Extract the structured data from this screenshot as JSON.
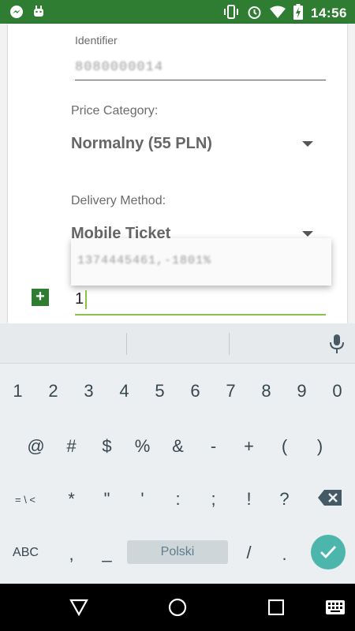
{
  "status_bar": {
    "time": "14:56",
    "left_icons": [
      "messenger-icon",
      "android-icon"
    ],
    "right_icons": [
      "vibrate-icon",
      "alarm-icon",
      "wifi-icon",
      "battery-icon"
    ]
  },
  "form": {
    "identifier_label": "Identifier",
    "identifier_value": "8080000014",
    "price_label": "Price Category:",
    "price_value": "Normalny (55 PLN)",
    "delivery_label": "Delivery Method:",
    "delivery_value": "Mobile Ticket",
    "autocomplete_suggestion": "1374445461,-1801%",
    "quantity_value": "1"
  },
  "keyboard": {
    "row1": [
      "1",
      "2",
      "3",
      "4",
      "5",
      "6",
      "7",
      "8",
      "9",
      "0"
    ],
    "row2": [
      "@",
      "#",
      "$",
      "%",
      "&",
      "-",
      "+",
      "(",
      ")"
    ],
    "row3": [
      "= \\ <",
      "*",
      "\"",
      "'",
      ":",
      ";",
      "!",
      "?"
    ],
    "row4_left": "ABC",
    "row4_comma": ",",
    "row4_underscore": "_",
    "spacebar_label": "Polski",
    "row4_slash": "/",
    "row4_period": "."
  },
  "colors": {
    "status_bar": "#2e7d32",
    "accent_green": "#8bc34a",
    "enter_teal": "#4db6ac"
  }
}
